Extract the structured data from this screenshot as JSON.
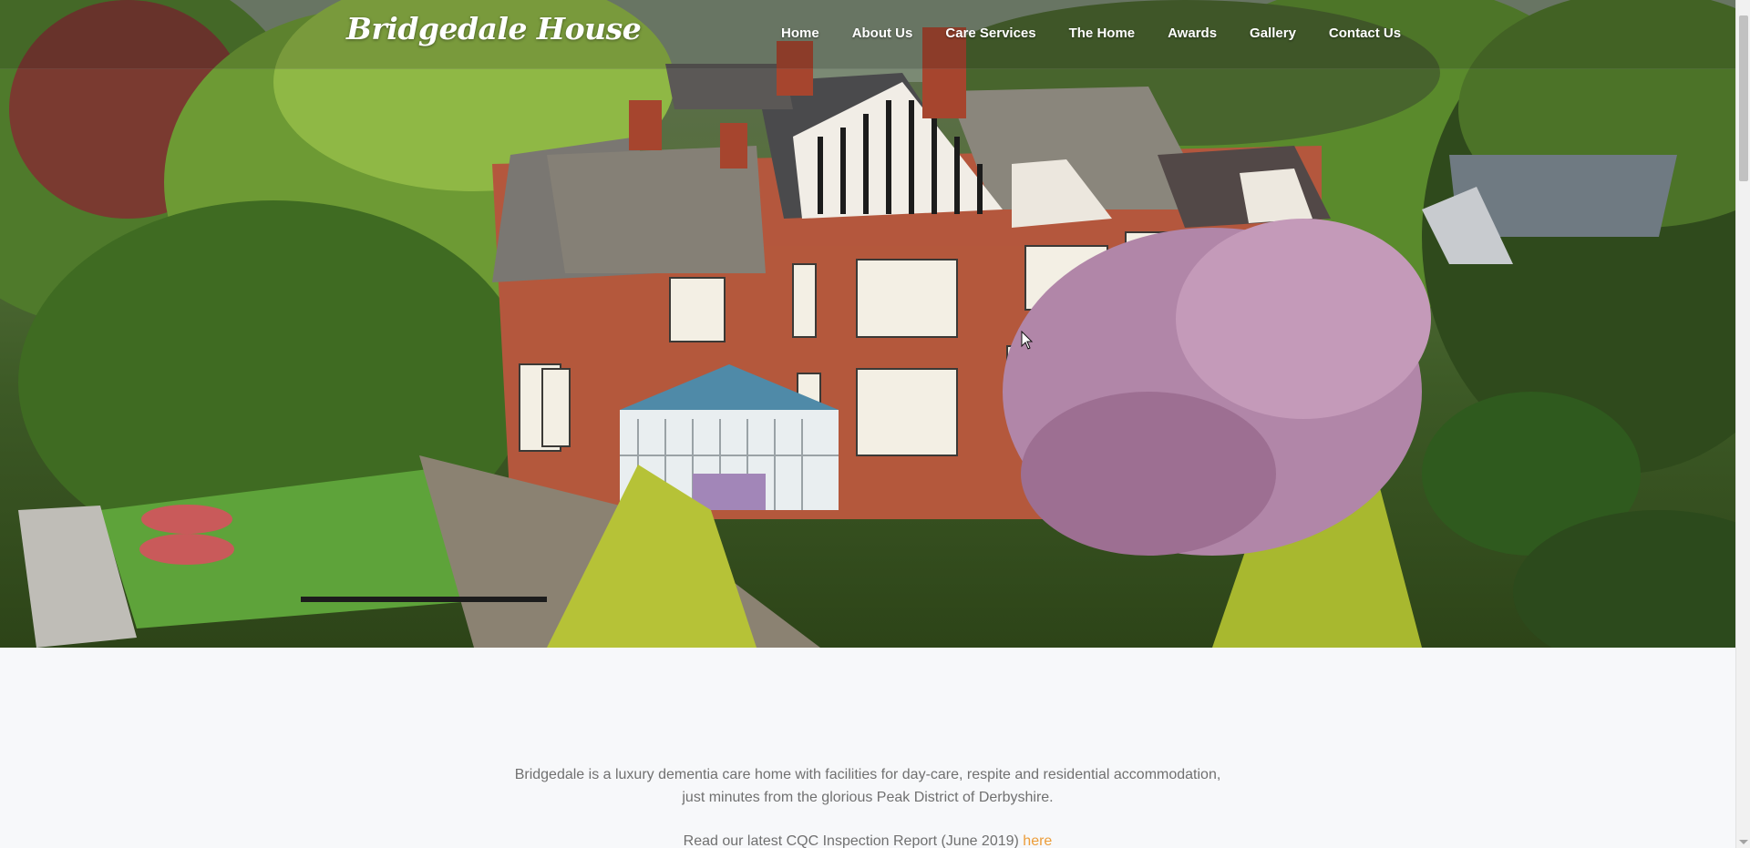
{
  "header": {
    "logo_text": "Bridgedale House",
    "nav": [
      {
        "label": "Home"
      },
      {
        "label": "About Us"
      },
      {
        "label": "Care Services"
      },
      {
        "label": "The Home"
      },
      {
        "label": "Awards"
      },
      {
        "label": "Gallery"
      },
      {
        "label": "Contact Us"
      }
    ]
  },
  "intro": {
    "description": "Bridgedale is a luxury dementia care home with facilities for day-care, respite and residential accommodation, just minutes from the glorious Peak District of Derbyshire.",
    "report_text": "Read our latest CQC Inspection Report (June 2019) ",
    "report_link": "here"
  },
  "colors": {
    "link_accent": "#ec9d3a",
    "body_text": "#707070",
    "page_background": "#f7f8fa"
  }
}
